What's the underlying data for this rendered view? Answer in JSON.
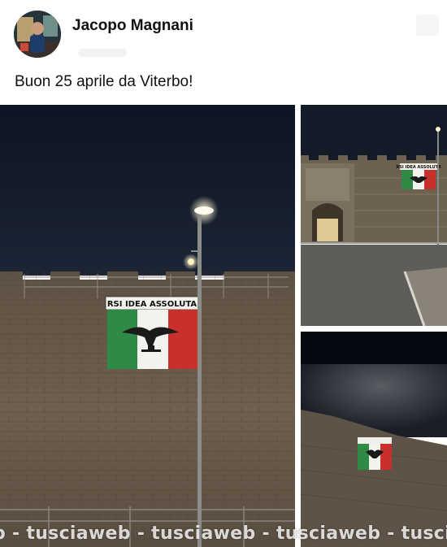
{
  "post": {
    "author_name": "Jacopo Magnani",
    "caption": "Buon 25 aprile da Viterbo!"
  },
  "photos": {
    "main_banner_text": "RSI IDEA ASSOLUTA",
    "top_right_banner_text": "RSI IDEA ASSOLUTA"
  },
  "watermark": {
    "text": "b - tusciaweb - tusciaweb - tusciaweb - tusci"
  },
  "icons": [
    "avatar",
    "more-options-icon"
  ],
  "colors": {
    "flag_green": "#2f8a46",
    "flag_white": "#f2f2ee",
    "flag_red": "#c9302c",
    "night_sky": "#141b2a",
    "wall": "#6b5d4c"
  }
}
